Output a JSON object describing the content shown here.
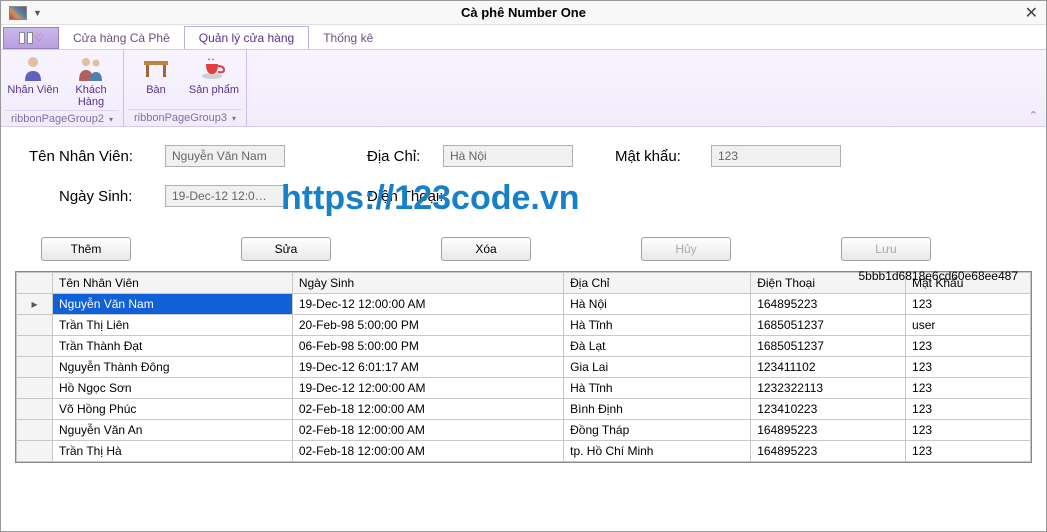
{
  "window": {
    "title": "Cà phê Number One"
  },
  "tabs": {
    "t1": "Cửa hàng Cà Phê",
    "t2": "Quản lý cửa hàng",
    "t3": "Thống kê"
  },
  "ribbon": {
    "nhanvien": "Nhân Viên",
    "khachhang": "Khách Hàng",
    "ban": "Bàn",
    "sanpham": "Sản phẩm",
    "group2": "ribbonPageGroup2",
    "group3": "ribbonPageGroup3"
  },
  "form": {
    "lbl_name": "Tên Nhân Viên:",
    "val_name": "Nguyễn Văn Nam",
    "lbl_addr": "Địa Chỉ:",
    "val_addr": "Hà Nội",
    "lbl_pass": "Mật khẩu:",
    "val_pass": "123",
    "lbl_dob": "Ngày Sinh:",
    "val_dob": "19-Dec-12 12:0…",
    "lbl_phone": "Điện Thoại:"
  },
  "watermark": "https://123code.vn",
  "hash": "5bbb1d6818e6cd60e68ee487",
  "buttons": {
    "them": "Thêm",
    "sua": "Sửa",
    "xoa": "Xóa",
    "huy": "Hủy",
    "luu": "Lưu"
  },
  "grid": {
    "headers": [
      "Tên Nhân Viên",
      "Ngày Sinh",
      "Địa Chỉ",
      "Điện Thoại",
      "Mật Khẩu"
    ],
    "rows": [
      [
        "Nguyễn Văn Nam",
        "19-Dec-12 12:00:00 AM",
        "Hà Nội",
        "164895223",
        "123"
      ],
      [
        "Trần Thị Liên",
        "20-Feb-98 5:00:00 PM",
        "Hà Tĩnh",
        "1685051237",
        "user"
      ],
      [
        "Trần Thành Đạt",
        "06-Feb-98 5:00:00 PM",
        "Đà Lạt",
        "1685051237",
        "123"
      ],
      [
        "Nguyễn Thành Đông",
        "19-Dec-12 6:01:17 AM",
        "Gia Lai",
        "123411102",
        "123"
      ],
      [
        "Hồ Ngọc Sơn",
        "19-Dec-12 12:00:00 AM",
        " Hà Tĩnh",
        "1232322113",
        " 123"
      ],
      [
        "Võ Hồng Phúc",
        "02-Feb-18 12:00:00 AM",
        "Bình Định",
        "123410223",
        "123"
      ],
      [
        "Nguyễn Văn An",
        "02-Feb-18 12:00:00 AM",
        "Đồng Tháp",
        "164895223",
        "123"
      ],
      [
        "Trần Thị Hà",
        "02-Feb-18 12:00:00 AM",
        "tp. Hồ Chí Minh",
        "164895223",
        "123"
      ]
    ]
  }
}
